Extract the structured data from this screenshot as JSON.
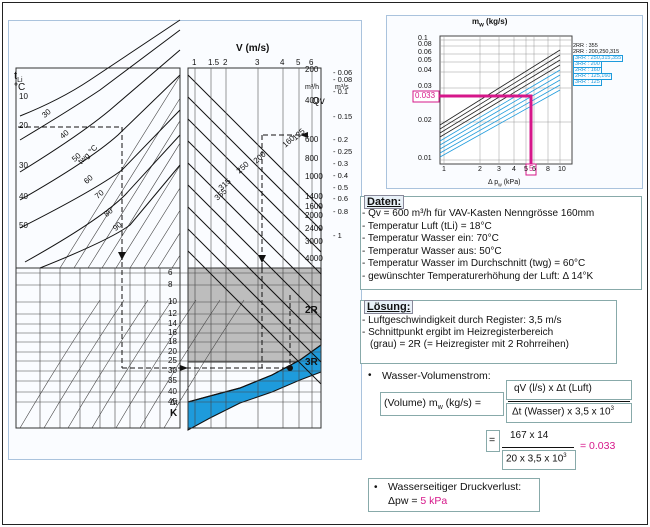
{
  "main_chart": {
    "top_axis_title": "V  (m/s)",
    "top_axis_ticks": [
      "1",
      "1.5",
      "2",
      "3",
      "4",
      "5",
      "6"
    ],
    "left_axis_title_line1": "t",
    "left_axis_title_sub": "Li",
    "left_axis_title_line2": "°C",
    "left_axis_ticks": [
      "10",
      "20",
      "30",
      "40",
      "50"
    ],
    "temp_curve_labels": [
      "30",
      "40",
      "50",
      "60",
      "70",
      "80",
      "90"
    ],
    "twg_label": "twg °C",
    "flow_axis_ticks_m3h": [
      "200",
      "400",
      "600",
      "800",
      "1000",
      "1400",
      "1600",
      "2000",
      "2400",
      "3000",
      "4000"
    ],
    "flow_unit_m3h": "m³/h",
    "flow_axis_ticks_m3s": [
      "0.06",
      "0.08",
      "0.1",
      "0.15",
      "0.2",
      "0.25",
      "0.3",
      "0.4",
      "0.5",
      "0.6",
      "0.8",
      "1"
    ],
    "flow_unit_m3s": "m³/s",
    "qv_label": "Qv",
    "size_labels": [
      "125",
      "160",
      "200",
      "250",
      "315",
      "355"
    ],
    "delta_t_ticks": [
      "6",
      "8",
      "10",
      "12",
      "14",
      "16",
      "18",
      "20",
      "25",
      "30",
      "35",
      "40",
      "45"
    ],
    "delta_t_label": "Δt",
    "delta_t_unit": "K",
    "region_2r": "2R",
    "region_3r": "3R",
    "colors": {
      "grey_region": "#bdbdbd",
      "blue_region": "#1e9bdc",
      "grid": "#333333"
    }
  },
  "small_chart": {
    "y_title": "m",
    "y_title_sub": "w",
    "y_unit": "(kg/s)",
    "y_ticks": [
      "0.1",
      "0.08",
      "0.06",
      "0.05",
      "0.04",
      "0.03",
      "0.02",
      "0.01"
    ],
    "x_ticks": [
      "1",
      "2",
      "3",
      "4",
      "5",
      "6",
      "8",
      "10"
    ],
    "x_title": "Δ p",
    "x_title_sub": "w",
    "x_unit": "(kPa)",
    "legend_lines": [
      "2RR : 355",
      "2RR : 200,250,315",
      "3RR : 250,315,355",
      "3RR : 200",
      "2RR : 160",
      "2RR : 125,160",
      "3RR : 125"
    ],
    "highlight_y": "0.033",
    "highlight_x": "5",
    "colors": {
      "highlight": "#d6178a",
      "blue_lines": "#1e9bdc"
    }
  },
  "daten": {
    "title": "Daten:",
    "items": [
      "Qv = 600 m³/h für VAV-Kasten Nenngrösse 160mm",
      "Temperatur Luft (tLi) = 18°C",
      "Temperatur Wasser ein: 70°C",
      "Temperatur Wasser aus: 50°C",
      "Temperatur Wasser im Durchschnitt (twg) = 60°C",
      "gewünschter Temperaturerhöhung der Luft: Δ 14°K"
    ]
  },
  "loesung": {
    "title": "Lösung:",
    "items": [
      "Luftgeschwindigkeit durch Register: 3,5 m/s",
      "Schnittpunkt ergibt im Heizregisterbereich",
      "(grau) = 2R (= Heizregister mit 2 Rohrreihen)"
    ],
    "wasser_title": "Wasser-Volumenstrom:",
    "formula_left": "(Volume) m",
    "formula_left_sub": "w",
    "formula_left_unit": " (kg/s) =",
    "formula_num": "qV (l/s) x Δt (Luft)",
    "formula_den": "Δt (Wasser) x 3,5 x 10",
    "formula_den_exp": "3",
    "calc_eq": "=",
    "calc_num": "167 x 14",
    "calc_den": "20 x 3,5 x 10",
    "calc_den_exp": "3",
    "calc_result": "= 0.033",
    "druck_title": "Wasserseitiger Druckverlust:",
    "druck_value_prefix": "Δpw = ",
    "druck_value": "5 kPa"
  }
}
